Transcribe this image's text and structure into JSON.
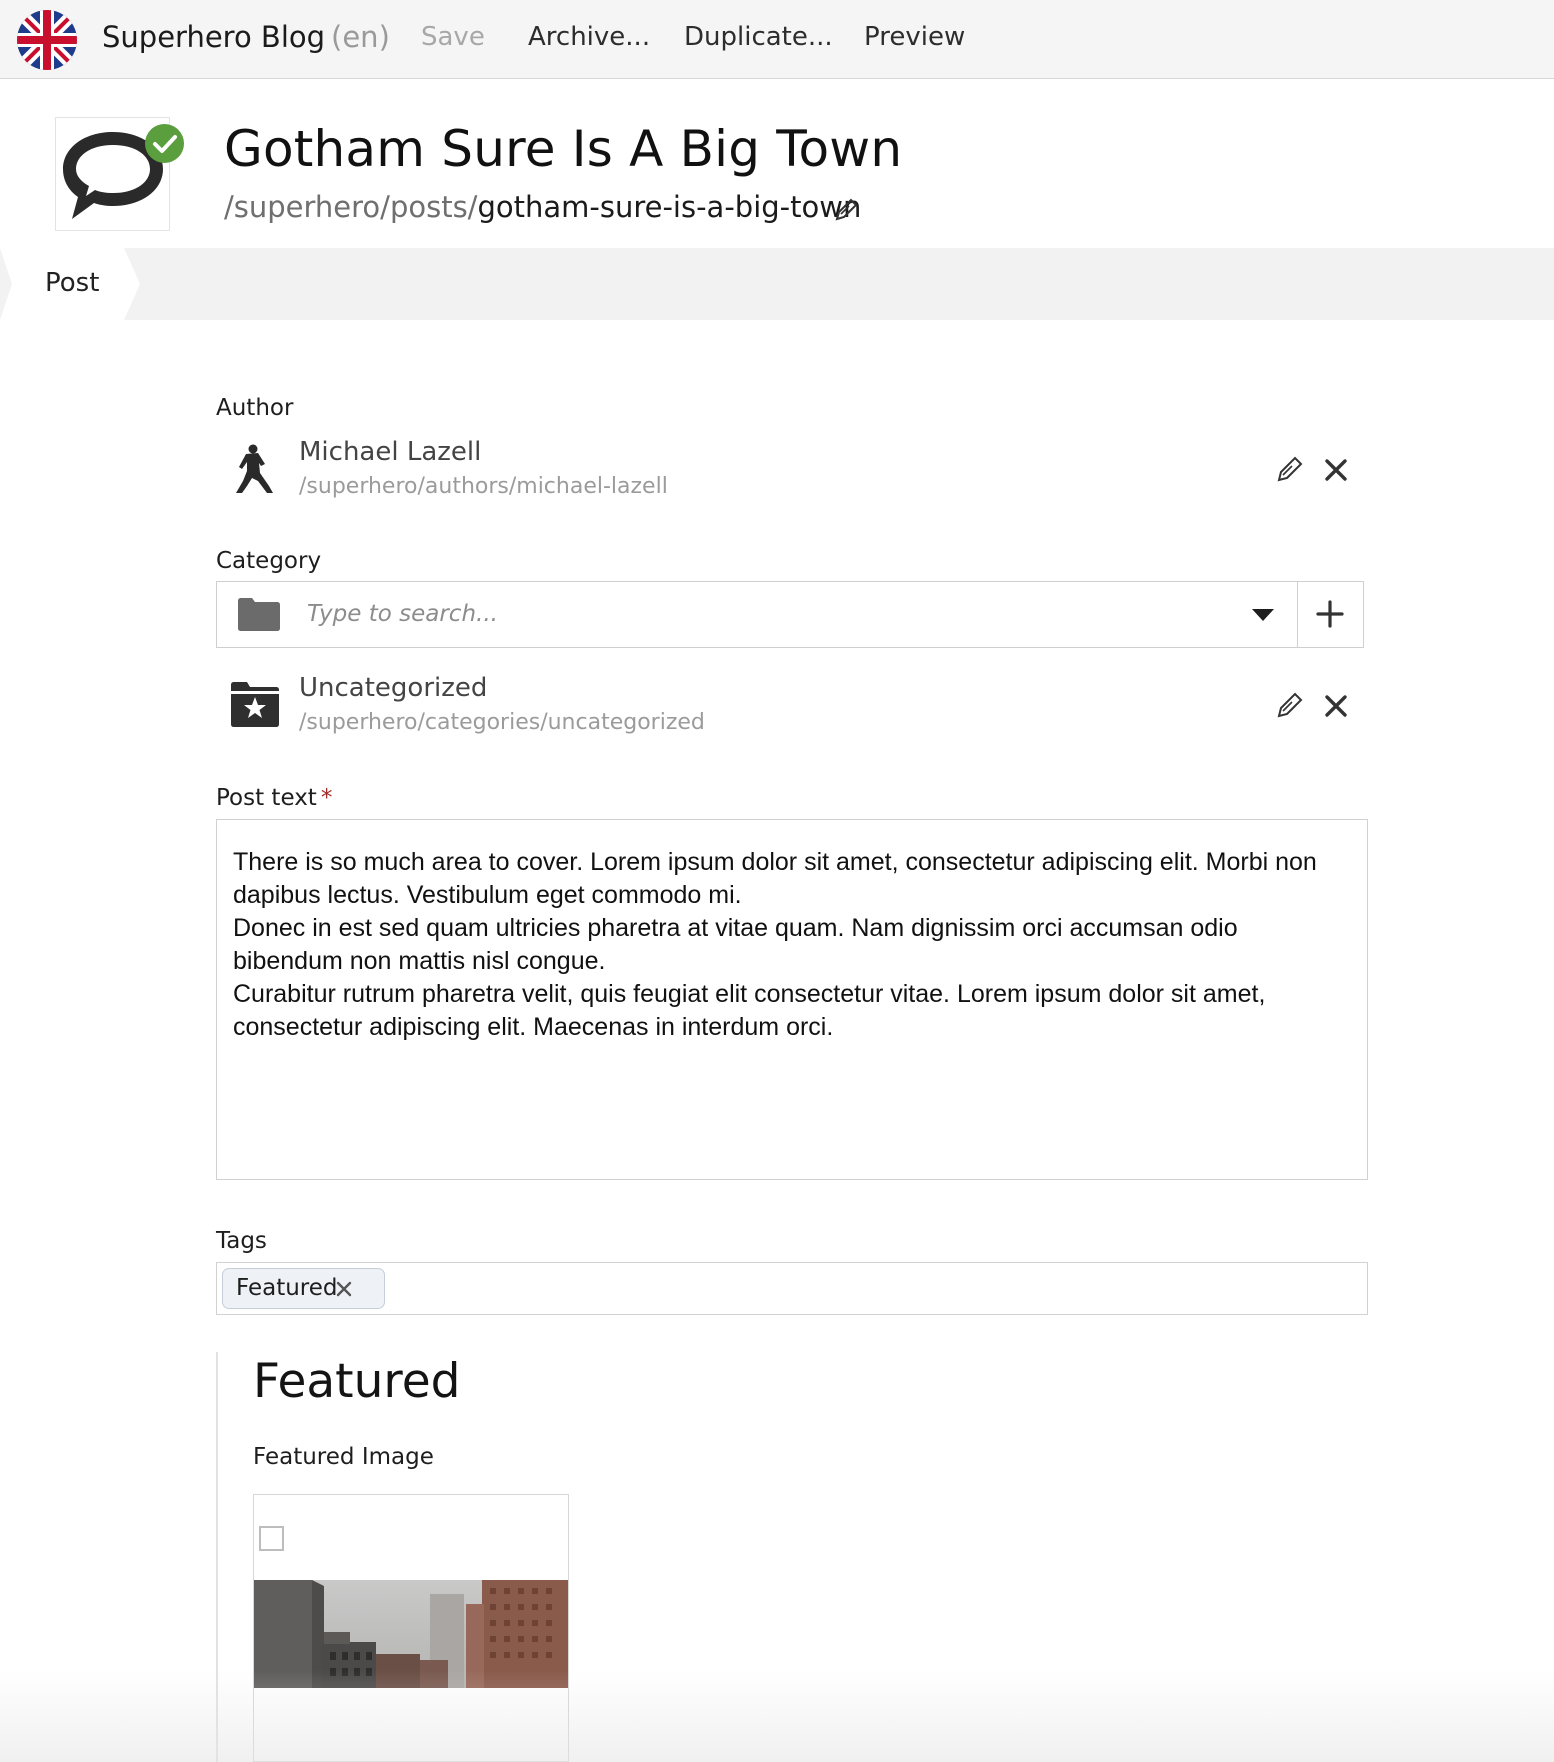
{
  "toolbar": {
    "site_name": "Superhero Blog",
    "locale": "(en)",
    "save_label": "Save",
    "archive_label": "Archive...",
    "duplicate_label": "Duplicate...",
    "preview_label": "Preview",
    "locale_flag_icon": "uk-flag-icon"
  },
  "header": {
    "title": "Gotham Sure Is A Big Town",
    "slug_prefix": "/superhero/posts/",
    "slug": "gotham-sure-is-a-big-town",
    "content_type_icon": "speech-bubble-icon",
    "status_icon": "published-check-icon",
    "status_color": "#5b9e3e"
  },
  "tabs": [
    {
      "label": "Post",
      "active": true
    }
  ],
  "form": {
    "author": {
      "label": "Author",
      "name": "Michael Lazell",
      "path": "/superhero/authors/michael-lazell",
      "icon": "superhero-figure-icon"
    },
    "category": {
      "label": "Category",
      "search_placeholder": "Type to search...",
      "selected_name": "Uncategorized",
      "selected_path": "/superhero/categories/uncategorized",
      "icon": "folder-star-icon"
    },
    "post_text": {
      "label": "Post text",
      "required_mark": "*",
      "paragraphs": [
        "There is so much area to cover. Lorem ipsum dolor sit amet, consectetur adipiscing elit. Morbi non dapibus lectus. Vestibulum eget commodo mi.",
        "Donec in est sed quam ultricies pharetra at vitae quam. Nam dignissim orci accumsan odio bibendum non mattis nisl congue.",
        "Curabitur rutrum pharetra velit, quis feugiat elit consectetur vitae. Lorem ipsum dolor sit amet, consectetur adipiscing elit. Maecenas in interdum orci."
      ]
    },
    "tags": {
      "label": "Tags",
      "items": [
        "Featured"
      ]
    },
    "featured": {
      "heading": "Featured",
      "image_label": "Featured Image"
    }
  },
  "colors": {
    "accent_green": "#5b9e3e",
    "required_red": "#a32c2c",
    "toolbar_bg": "#f5f5f5"
  }
}
